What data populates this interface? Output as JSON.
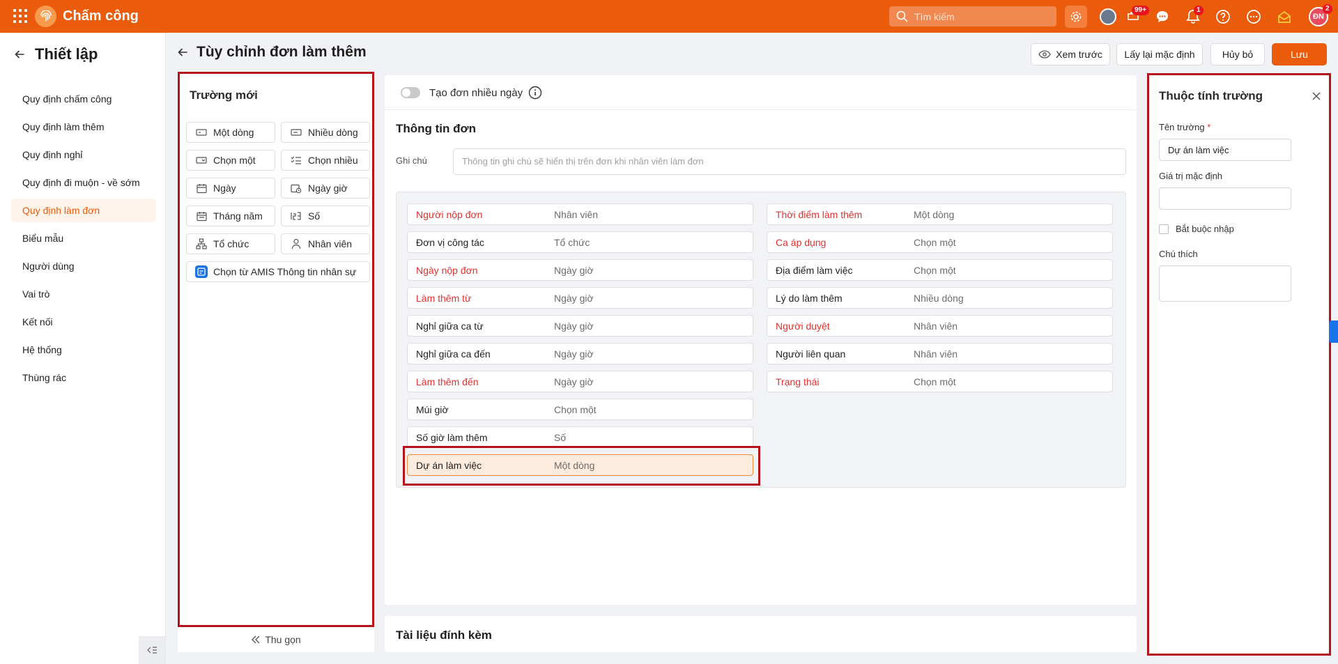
{
  "topbar": {
    "app_title": "Chấm công",
    "search_placeholder": "Tìm kiếm",
    "badge_tasks": "99+",
    "badge_notifications": "1",
    "badge_avatar": "2",
    "avatar_initials": "ĐN",
    "brand_color": "#ea5b0c"
  },
  "sidebar": {
    "title": "Thiết lập",
    "items": [
      {
        "label": "Quy định chấm công"
      },
      {
        "label": "Quy định làm thêm"
      },
      {
        "label": "Quy định nghỉ"
      },
      {
        "label": "Quy định đi muộn - về sớm"
      },
      {
        "label": "Quy định làm đơn"
      },
      {
        "label": "Biểu mẫu"
      },
      {
        "label": "Người dùng"
      },
      {
        "label": "Vai trò"
      },
      {
        "label": "Kết nối"
      },
      {
        "label": "Hệ thống"
      },
      {
        "label": "Thùng rác"
      }
    ],
    "active": "Quy định làm đơn"
  },
  "page": {
    "title": "Tùy chỉnh đơn làm thêm",
    "preview": "Xem trước",
    "reset": "Lấy lại mặc định",
    "cancel": "Hủy bỏ",
    "save": "Lưu"
  },
  "new_fields": {
    "title": "Trường mới",
    "items": [
      {
        "label": "Một dòng",
        "icon": "single-line-icon"
      },
      {
        "label": "Nhiều dòng",
        "icon": "multi-line-icon"
      },
      {
        "label": "Chọn một",
        "icon": "dropdown-icon"
      },
      {
        "label": "Chọn nhiều",
        "icon": "checklist-icon"
      },
      {
        "label": "Ngày",
        "icon": "calendar-icon"
      },
      {
        "label": "Ngày giờ",
        "icon": "datetime-icon"
      },
      {
        "label": "Tháng năm",
        "icon": "month-icon"
      },
      {
        "label": "Số",
        "icon": "number-icon"
      },
      {
        "label": "Tổ chức",
        "icon": "org-icon"
      },
      {
        "label": "Nhân viên",
        "icon": "person-icon"
      }
    ],
    "amis": "Chọn từ AMIS Thông tin nhân sự",
    "collapse": "Thu gọn"
  },
  "form": {
    "multi_day": "Tạo đơn nhiều ngày",
    "section_title": "Thông tin đơn",
    "note_label": "Ghi chú",
    "note_placeholder": "Thông tin ghi chú sẽ hiển thị trên đơn khi nhân viên làm đơn",
    "left_fields": [
      {
        "name": "Người nộp đơn",
        "type": "Nhân viên",
        "required": true
      },
      {
        "name": "Đơn vị công tác",
        "type": "Tổ chức",
        "required": false
      },
      {
        "name": "Ngày nộp đơn",
        "type": "Ngày giờ",
        "required": true
      },
      {
        "name": "Làm thêm từ",
        "type": "Ngày giờ",
        "required": true
      },
      {
        "name": "Nghỉ giữa ca từ",
        "type": "Ngày giờ",
        "required": false
      },
      {
        "name": "Nghỉ giữa ca đến",
        "type": "Ngày giờ",
        "required": false
      },
      {
        "name": "Làm thêm đến",
        "type": "Ngày giờ",
        "required": true
      },
      {
        "name": "Múi giờ",
        "type": "Chọn một",
        "required": false
      },
      {
        "name": "Số giờ làm thêm",
        "type": "Số",
        "required": false
      },
      {
        "name": "Dự án làm việc",
        "type": "Một dòng",
        "required": false,
        "selected": true
      }
    ],
    "right_fields": [
      {
        "name": "Thời điểm làm thêm",
        "type": "Một dòng",
        "required": true
      },
      {
        "name": "Ca áp dụng",
        "type": "Chọn một",
        "required": true
      },
      {
        "name": "Địa điểm làm việc",
        "type": "Chọn một",
        "required": false
      },
      {
        "name": "Lý do làm thêm",
        "type": "Nhiều dòng",
        "required": false
      },
      {
        "name": "Người duyệt",
        "type": "Nhân viên",
        "required": true
      },
      {
        "name": "Người liên quan",
        "type": "Nhân viên",
        "required": false
      },
      {
        "name": "Trạng thái",
        "type": "Chọn một",
        "required": true
      }
    ],
    "attachments": "Tài liệu đính kèm"
  },
  "props": {
    "title": "Thuộc tính trường",
    "name_label": "Tên trường",
    "required_mark": "*",
    "name_value": "Dự án làm việc",
    "default_label": "Giá trị mặc định",
    "default_value": "",
    "mandatory_label": "Bắt buộc nhập",
    "note_label": "Chú thích"
  }
}
